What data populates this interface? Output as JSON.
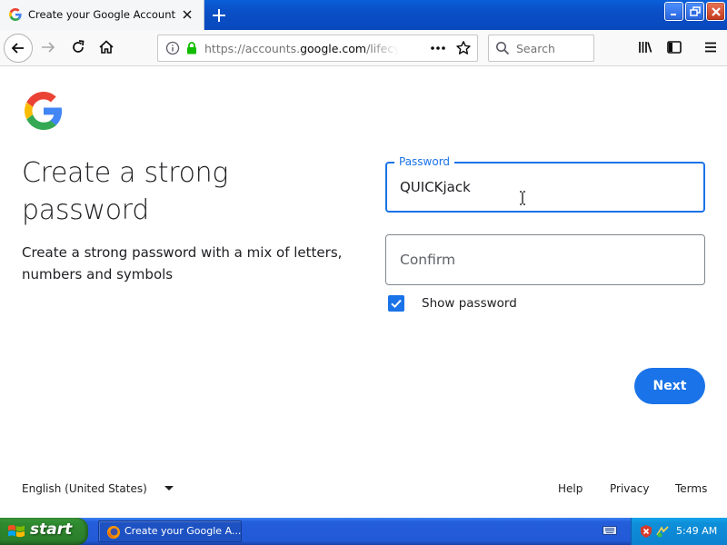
{
  "browser": {
    "tab": {
      "title": "Create your Google Account",
      "favicon": "google-g-icon"
    },
    "urlbar": {
      "url_prefix": "https://accounts.",
      "url_domain": "google.com",
      "url_suffix": "/lifecycle",
      "secure": true
    },
    "searchbar": {
      "placeholder": "Search"
    }
  },
  "page": {
    "heading": "Create a strong password",
    "description": "Create a strong password with a mix of letters, numbers and symbols",
    "password_field": {
      "label": "Password",
      "value": "QUICKjack"
    },
    "confirm_field": {
      "placeholder": "Confirm",
      "value": ""
    },
    "show_password": {
      "label": "Show password",
      "checked": true
    },
    "next_label": "Next"
  },
  "footer": {
    "language": "English (United States)",
    "links": [
      "Help",
      "Privacy",
      "Terms"
    ]
  },
  "taskbar": {
    "start_label": "start",
    "task_label": "Create your Google A...",
    "clock": "5:49 AM"
  },
  "colors": {
    "accent": "#1a73e8",
    "google_blue": "#4285F4",
    "google_red": "#EA4335",
    "google_yellow": "#FBBC05",
    "google_green": "#34A853"
  }
}
